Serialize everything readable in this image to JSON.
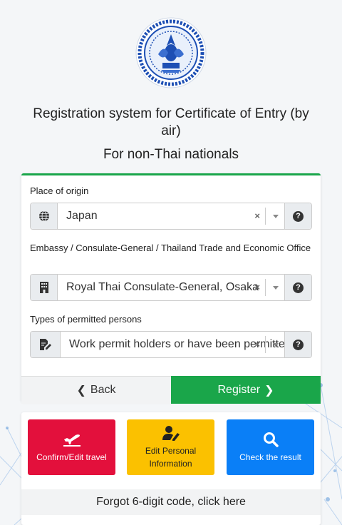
{
  "header": {
    "title": "Registration system for Certificate of Entry (by air)",
    "subtitle": "For non-Thai nationals",
    "emblem_icon": "thai-government-emblem"
  },
  "form": {
    "origin": {
      "label": "Place of origin",
      "value": "Japan",
      "icon": "globe-icon"
    },
    "embassy": {
      "label": "Embassy / Consulate-General / Thailand Trade and Economic Office",
      "value": "Royal Thai Consulate-General, Osaka",
      "icon": "building-icon"
    },
    "permitted": {
      "label": "Types of permitted persons",
      "value": "Work permit holders or have been permitted",
      "icon": "document-edit-icon"
    },
    "clear_symbol": "×",
    "help_symbol": "?",
    "back_chevron": "❮",
    "next_chevron": "❯",
    "back_label": "Back",
    "register_label": "Register"
  },
  "menu": {
    "confirm": {
      "label": "Confirm/Edit travel",
      "icon": "airplane-icon"
    },
    "edit": {
      "label": "Edit Personal Information",
      "icon": "user-edit-icon"
    },
    "check": {
      "label": "Check the result",
      "icon": "search-icon"
    },
    "forgot": "Forgot 6-digit code, click here"
  },
  "colors": {
    "accent_green": "#1aa64a",
    "tile_red": "#e3103c",
    "tile_yellow": "#fbc100",
    "tile_blue": "#0a7ff7"
  }
}
